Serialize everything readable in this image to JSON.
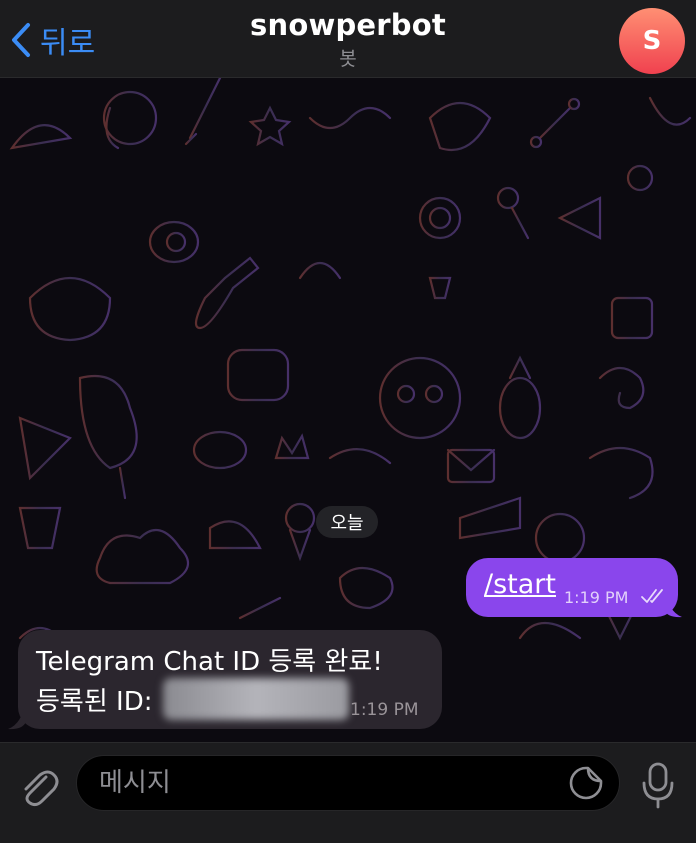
{
  "header": {
    "back_label": "뒤로",
    "title": "snowperbot",
    "subtitle": "봇",
    "avatar_initial": "S",
    "avatar_color": "#f35a5a",
    "accent_color": "#3b8cf5"
  },
  "chat": {
    "date_divider": "오늘",
    "messages": [
      {
        "direction": "outgoing",
        "text": "/start",
        "time": "1:19 PM",
        "status_icon": "double-check-icon",
        "bubble_color": "#8a46ec"
      },
      {
        "direction": "incoming",
        "line1": "Telegram Chat ID 등록 완료!",
        "line2": "등록된 ID:",
        "time": "1:19 PM",
        "bubble_color": "#2b262e"
      }
    ]
  },
  "composer": {
    "placeholder": "메시지",
    "icons": [
      "paperclip-icon",
      "sticker-icon",
      "microphone-icon"
    ]
  }
}
